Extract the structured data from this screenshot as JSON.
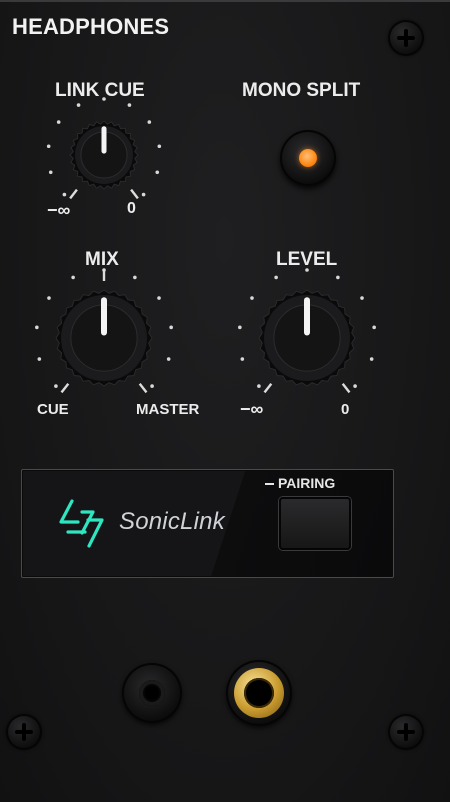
{
  "header": {
    "title": "HEADPHONES"
  },
  "link_cue": {
    "label": "LINK CUE",
    "min_label": "−∞",
    "max_label": "0",
    "value": 0.5
  },
  "mono_split": {
    "label": "MONO SPLIT",
    "active": true,
    "led_color": "#ff8c1a"
  },
  "mix": {
    "label": "MIX",
    "min_label": "CUE",
    "max_label": "MASTER",
    "value": 0.5
  },
  "level": {
    "label": "LEVEL",
    "min_label": "−∞",
    "max_label": "0",
    "value": 0.5
  },
  "sonic_link": {
    "brand": "SonicLink",
    "pairing_label": "PAIRING",
    "logo_color": "#2ee6c0"
  },
  "colors": {
    "panel": "#161617",
    "text": "#ececec",
    "accent_orange": "#ff8c1a",
    "brass": "#c99a2e"
  }
}
